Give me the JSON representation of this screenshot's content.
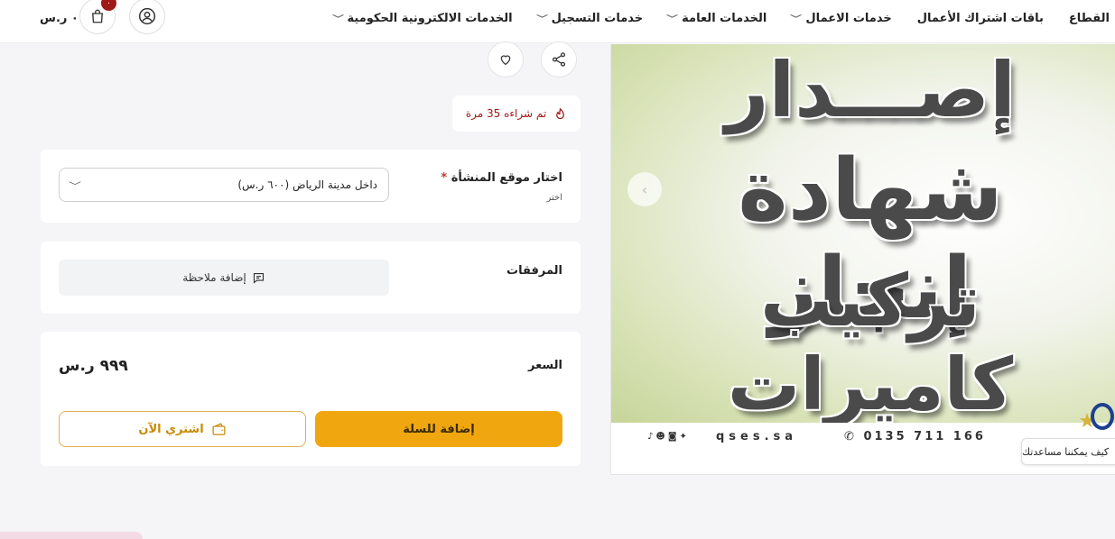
{
  "nav": {
    "items": [
      {
        "label": "الخدمات الالكترونية الحكومية",
        "has_dropdown": true
      },
      {
        "label": "خدمات التسجيل",
        "has_dropdown": true
      },
      {
        "label": "الخدمات العامة",
        "has_dropdown": true
      },
      {
        "label": "خدمات الاعمال",
        "has_dropdown": true
      },
      {
        "label": "باقات اشتراك الأعمال",
        "has_dropdown": false
      },
      {
        "label": "القطاع",
        "has_dropdown": false
      }
    ],
    "cart_count": "٠",
    "cart_total": "٠ ر.س"
  },
  "promo": {
    "line1": "إصـــدار",
    "line2": "شهادة إنجاز",
    "line3": "تركيب كاميرات",
    "phone": "0135 711 166",
    "site": "qses.sa"
  },
  "product": {
    "sold_text": "تم شراءه 35 مرة",
    "location_label": "اختار موقع المنشأة",
    "location_required": "*",
    "location_hint": "اختر",
    "location_value": "داخل مدينة الرياض (٦٠٠ ر.س)",
    "attachments_label": "المرفقات",
    "add_note_label": "إضافة ملاحظة",
    "price_label": "السعر",
    "price_value": "٩٩٩ ر.س",
    "add_to_cart_label": "إضافة للسلة",
    "buy_now_label": "اشتري الآن"
  },
  "help": {
    "text": "كيف يمكننا مساعدتك"
  },
  "colors": {
    "accent": "#f0a70f",
    "danger": "#a01919"
  }
}
